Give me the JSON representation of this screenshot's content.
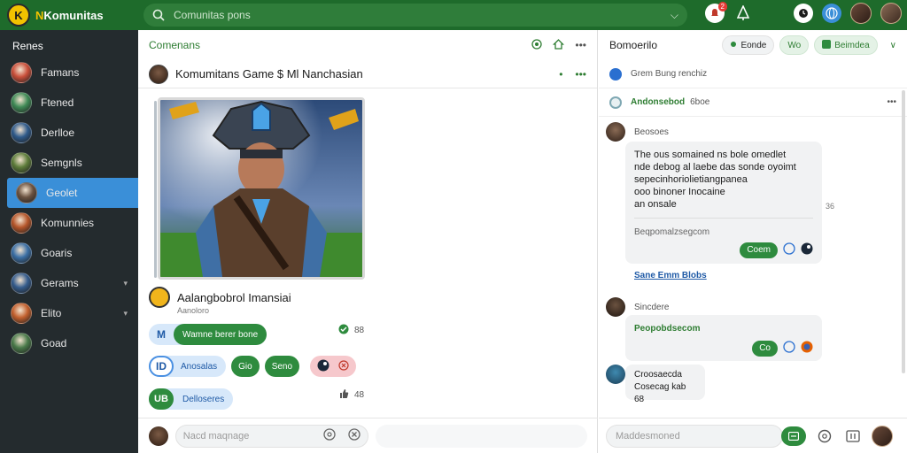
{
  "topbar": {
    "logo_mark": "K",
    "logo_prefix": "N",
    "logo_text": "Komunitas",
    "search_placeholder": "Comunitas pons",
    "notif_count": "2"
  },
  "sidebar": {
    "title": "Renes",
    "items": [
      {
        "label": "Famans",
        "color": "#c94f3a"
      },
      {
        "label": "Ftened",
        "color": "#3f8a56"
      },
      {
        "label": "Derlloe",
        "color": "#2f5a8a"
      },
      {
        "label": "Semgnls",
        "color": "#5d7c3a"
      },
      {
        "label": "Geolet",
        "color": "#6b5240",
        "active": true
      },
      {
        "label": "Komunnies",
        "color": "#b5562a"
      },
      {
        "label": "Goaris",
        "color": "#3b6fa5"
      },
      {
        "label": "Gerams",
        "color": "#355c8c",
        "caret": true
      },
      {
        "label": "Elito",
        "color": "#c2602e",
        "caret": true
      },
      {
        "label": "Goad",
        "color": "#4a7a4a"
      }
    ]
  },
  "middle": {
    "title": "Comenans",
    "post_title": "Komumitans Game $ Ml Nanchasian",
    "author": "Aalangbobrol Imansiai",
    "author_sub": "Aanoloro",
    "reactions": {
      "row1_tag": "M",
      "row1_label": "Wamne berer bone",
      "row1_count": "88",
      "row2_tag": "ID",
      "row2_label": "Anosalas",
      "row2_g1": "Gio",
      "row2_g2": "Seno",
      "row3_tag": "UB",
      "row3_label": "Delloseres",
      "row3_count": "48"
    },
    "compose_placeholder": "Nacd maqnage"
  },
  "right": {
    "title": "Bomoerilo",
    "chip1": "Eonde",
    "chip2": "Wo",
    "chip3": "Beimdea",
    "row1": "Grem Bung renchiz",
    "row2_prefix": "Andonsebod",
    "row2_suffix": "6boe",
    "msg1_author": "Beosoes",
    "msg1_lines": [
      "The ous somained ns bole omedlet",
      "nde debog al laebe das sonde oyoimt",
      "sepecinhoriolietiangpanea",
      "ooo binoner Inocaine",
      "an onsale"
    ],
    "msg1_time": "36",
    "msg1_sub": "Beqpomalzsegcom",
    "msg1_btn": "Coem",
    "link": "Sane Emm Blobs",
    "msg2_author": "Sincdere",
    "msg2_text": "Peopobdsecom",
    "msg2_btn": "Co",
    "msg3_line1": "Croosaecda",
    "msg3_line2": "Cosecag kab 68",
    "compose_placeholder": "Maddesmoned"
  }
}
